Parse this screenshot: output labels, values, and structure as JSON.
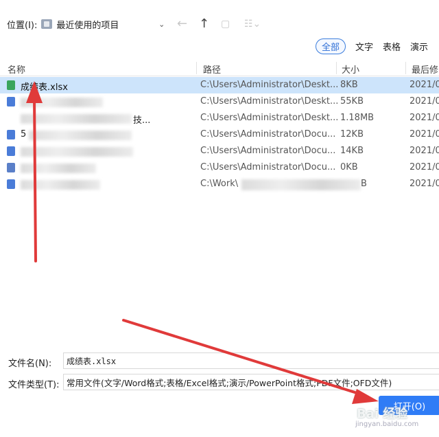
{
  "location": {
    "label": "位置(I):",
    "value": "最近使用的项目"
  },
  "filters": {
    "all": "全部",
    "text": "文字",
    "sheet": "表格",
    "show": "演示"
  },
  "columns": {
    "name": "名称",
    "path": "路径",
    "size": "大小",
    "modified": "最后修"
  },
  "rows": [
    {
      "name": "成绩表.xlsx",
      "path": "C:\\Users\\Administrator\\Deskt...",
      "size": "8KB",
      "date": "2021/0",
      "icon": "excel-file-icon"
    },
    {
      "name": "",
      "path": "C:\\Users\\Administrator\\Deskt...",
      "size": "55KB",
      "date": "2021/0",
      "icon": "word-file-icon"
    },
    {
      "name": "技...",
      "path": "C:\\Users\\Administrator\\Deskt...",
      "size": "1.18MB",
      "date": "2021/0",
      "icon": ""
    },
    {
      "name": "5",
      "path": "C:\\Users\\Administrator\\Docu...",
      "size": "12KB",
      "date": "2021/0",
      "icon": "word-file-icon"
    },
    {
      "name": "",
      "path": "C:\\Users\\Administrator\\Docu...",
      "size": "14KB",
      "date": "2021/0",
      "icon": "word-file-icon"
    },
    {
      "name": "",
      "path": "C:\\Users\\Administrator\\Docu...",
      "size": "0KB",
      "date": "2021/0",
      "icon": "excel-file-icon"
    },
    {
      "name": "",
      "path": "C:\\Work\\",
      "size": "B",
      "date": "2021/0",
      "icon": "word-file-icon"
    }
  ],
  "bottom": {
    "filename_label": "文件名(N):",
    "filename_value": "成绩表.xlsx",
    "filetype_label": "文件类型(T):",
    "filetype_value": "常用文件(文字/Word格式;表格/Excel格式;演示/PowerPoint格式;PDF文件;OFD文件)",
    "open_label": "打开(O)"
  },
  "watermark": {
    "main": "Bai 经验",
    "sub": "jingyan.baidu.com"
  },
  "colors": {
    "accent": "#2f7cf6",
    "selection": "#cde4fb",
    "arrow": "#e03a3a"
  }
}
